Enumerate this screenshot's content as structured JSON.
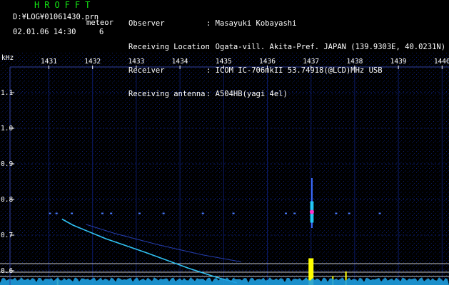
{
  "header": {
    "app_title": "HROFFT",
    "file_path": "D:¥LOG¥01061430.prn",
    "mode_label": "meteor",
    "timestamp": "02.01.06 14:30",
    "detection_count": "6"
  },
  "station_info": {
    "labels": [
      "Observer",
      "Receiving Location",
      "Receiver",
      "Receiving antenna"
    ],
    "values": [
      ": Masayuki Kobayashi",
      ": Ogata-vill. Akita-Pref. JAPAN (139.9303E, 40.0231N)",
      ": ICOM IC-706mkII 53.74918(@LCD)MHz USB",
      ": A504HB(yagi 4el)"
    ]
  },
  "colors": {
    "background": "#000000",
    "title_green": "#14e614",
    "grid_blue": "#0a1a66",
    "trail_cyan": "#33ccff",
    "echo_yellow": "#ffff00",
    "echo_magenta": "#ff33cc"
  },
  "chart_data": {
    "type": "heatmap",
    "x_unit": "Hz",
    "y_unit": "kHz",
    "x_ticks": [
      "1431",
      "1432",
      "1433",
      "1434",
      "1435",
      "1436",
      "1437",
      "1438",
      "1439",
      "1440"
    ],
    "y_ticks": [
      "1.1",
      "1.0",
      "0.9",
      "0.8",
      "0.7",
      "0.6"
    ],
    "xlim": [
      1430.8,
      1440.3
    ],
    "ylim": [
      0.56,
      1.2
    ],
    "reference_lines_khz": [
      0.62,
      0.596,
      0.584
    ],
    "meteor_trails": [
      {
        "points": [
          [
            1431.3,
            0.745
          ],
          [
            1431.55,
            0.728
          ],
          [
            1432.3,
            0.69
          ],
          [
            1433.2,
            0.652
          ],
          [
            1434.2,
            0.607
          ],
          [
            1434.8,
            0.583
          ],
          [
            1435.3,
            0.566
          ]
        ]
      },
      {
        "points": [
          [
            1431.85,
            0.73
          ],
          [
            1432.5,
            0.705
          ],
          [
            1433.5,
            0.673
          ],
          [
            1434.5,
            0.645
          ],
          [
            1435.4,
            0.625
          ]
        ]
      }
    ],
    "head_echo": {
      "x_hz": 1437.02,
      "y_top_khz": 0.86,
      "y_bottom_khz": 0.72,
      "peak_khz": 0.765
    },
    "yellow_spikes": [
      {
        "x_hz": 1437.0,
        "top_khz": 0.635
      },
      {
        "x_hz": 1437.5,
        "top_khz": 0.585
      },
      {
        "x_hz": 1437.8,
        "top_khz": 0.598
      },
      {
        "x_hz": 1431.2,
        "top_khz": 0.575
      }
    ],
    "dot_row_khz": 0.761,
    "dot_row_x_hz": [
      1431.0,
      1431.15,
      1431.5,
      1432.2,
      1432.4,
      1433.05,
      1433.6,
      1434.5,
      1435.2,
      1436.4,
      1436.6,
      1437.55,
      1437.85,
      1438.55
    ]
  }
}
